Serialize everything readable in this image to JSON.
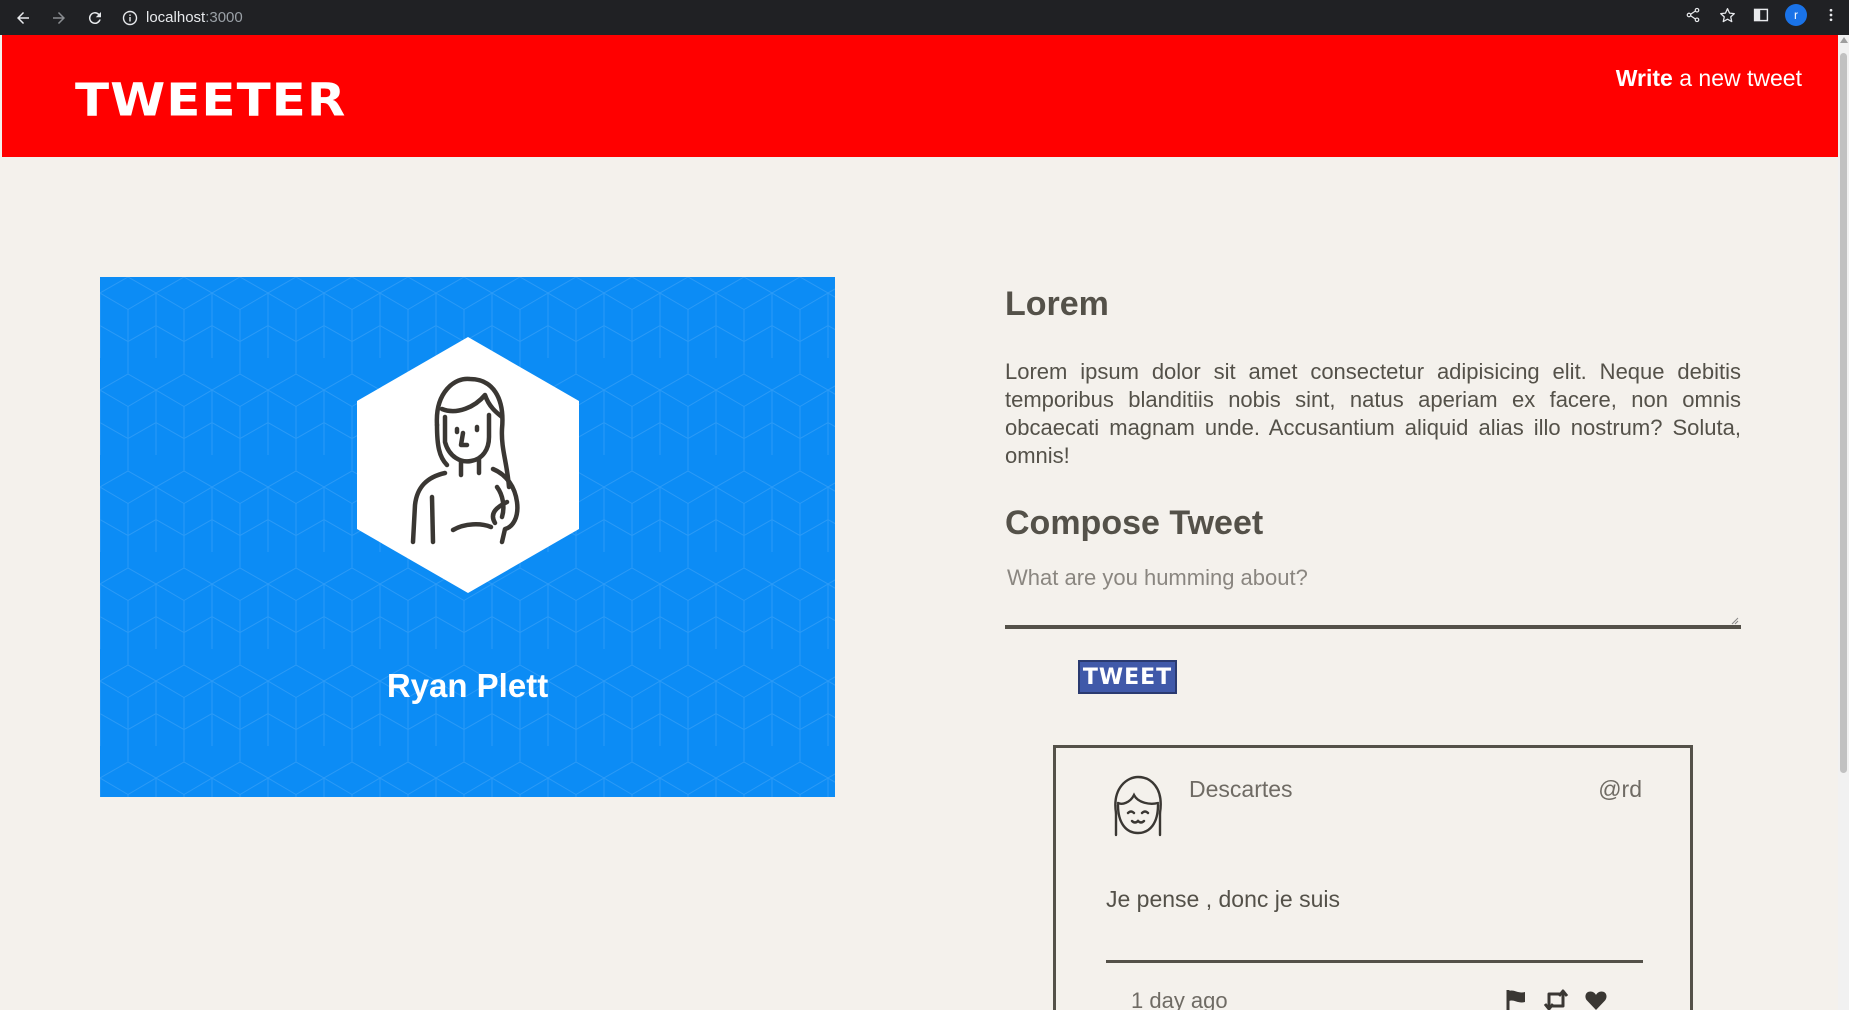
{
  "browser": {
    "url_host": "localhost",
    "url_port": ":3000",
    "profile_initial": "r"
  },
  "header": {
    "logo": "TWEETER",
    "write_bold": "Write",
    "write_rest": " a new tweet"
  },
  "profile": {
    "name": "Ryan Plett"
  },
  "about": {
    "title": "Lorem",
    "text": "Lorem ipsum dolor sit amet consectetur adipisicing elit. Neque debitis temporibus blanditiis nobis sint, natus aperiam ex facere, non omnis obcaecati magnam unde. Accusantium aliquid alias illo nostrum? Soluta, omnis!"
  },
  "compose": {
    "title": "Compose Tweet",
    "placeholder": "What are you humming about?",
    "button_label": "TWEET"
  },
  "tweets": [
    {
      "author": "Descartes",
      "handle": "@rd",
      "content": "Je pense , donc je suis",
      "time": "1 day ago"
    }
  ],
  "colors": {
    "header_bg": "#ff0000",
    "profile_bg": "#0c8cf5",
    "page_bg": "#f4f1ec",
    "text": "#545149",
    "button_bg": "#4059a9"
  }
}
